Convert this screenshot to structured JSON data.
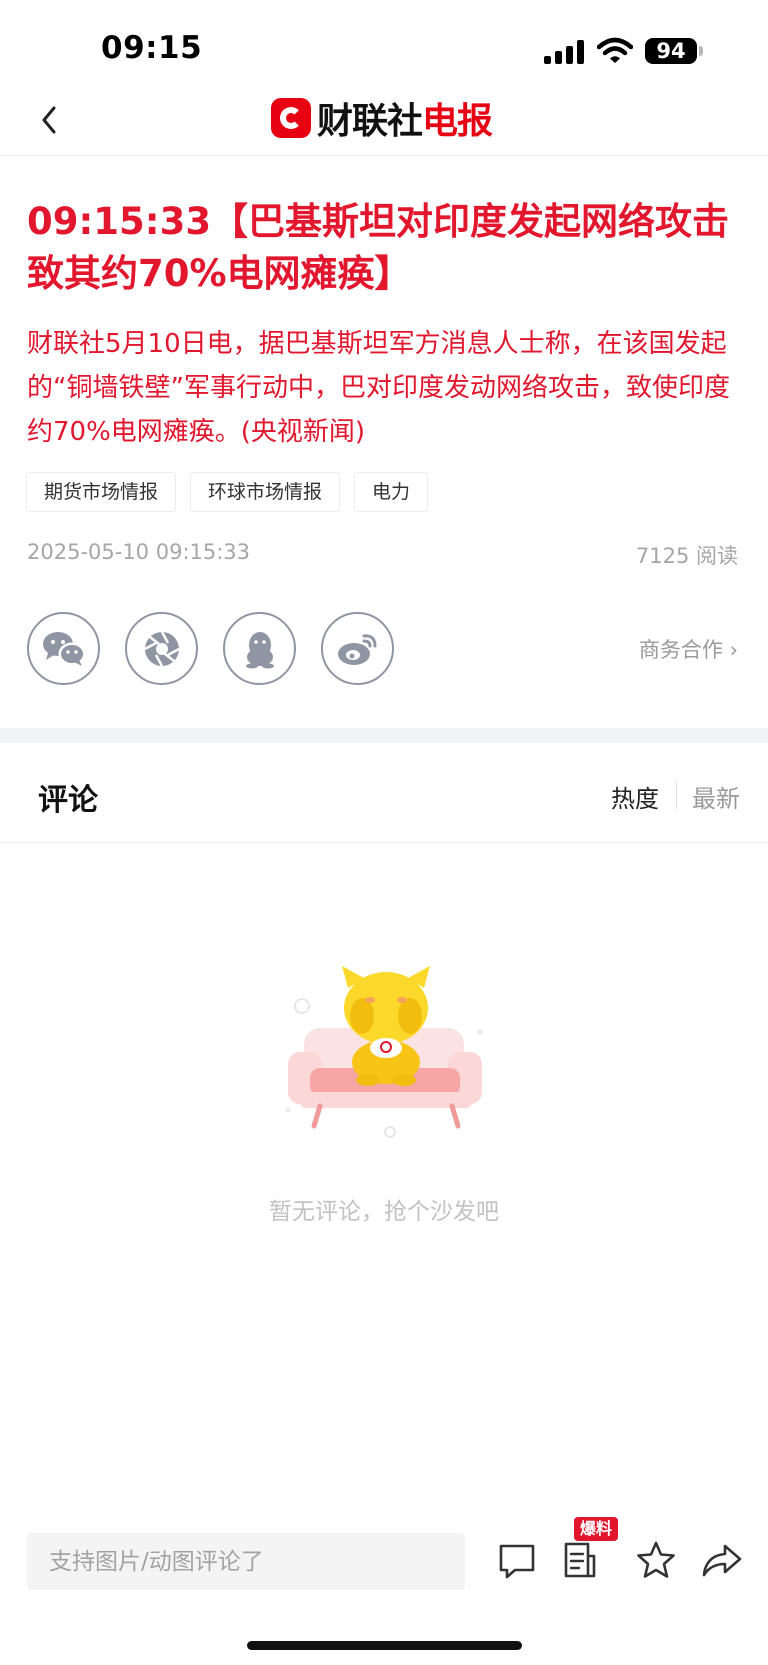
{
  "status_bar": {
    "time": "09:15",
    "battery": "94"
  },
  "nav": {
    "logo_black": "财联社",
    "logo_red": "电报"
  },
  "article": {
    "title": "09:15:33【巴基斯坦对印度发起网络攻击致其约70%电网瘫痪】",
    "body": "财联社5月10日电，据巴基斯坦军方消息人士称，在该国发起的“铜墙铁壁”军事行动中，巴对印度发动网络攻击，致使印度约70%电网瘫痪。(央视新闻)",
    "tags": [
      "期货市场情报",
      "环球市场情报",
      "电力"
    ],
    "timestamp": "2025-05-10 09:15:33",
    "reads": "7125 阅读",
    "business_link": "商务合作 ›"
  },
  "share": {
    "icons": [
      "wechat-icon",
      "moments-icon",
      "qq-icon",
      "weibo-icon"
    ]
  },
  "comments": {
    "title": "评论",
    "sort_hot": "热度",
    "sort_new": "最新",
    "empty_text": "暂无评论，抢个沙发吧"
  },
  "bottom_bar": {
    "input_placeholder": "支持图片/动图评论了",
    "badge": "爆料"
  },
  "colors": {
    "accent": "#e2162c",
    "brand": "#e60012"
  }
}
